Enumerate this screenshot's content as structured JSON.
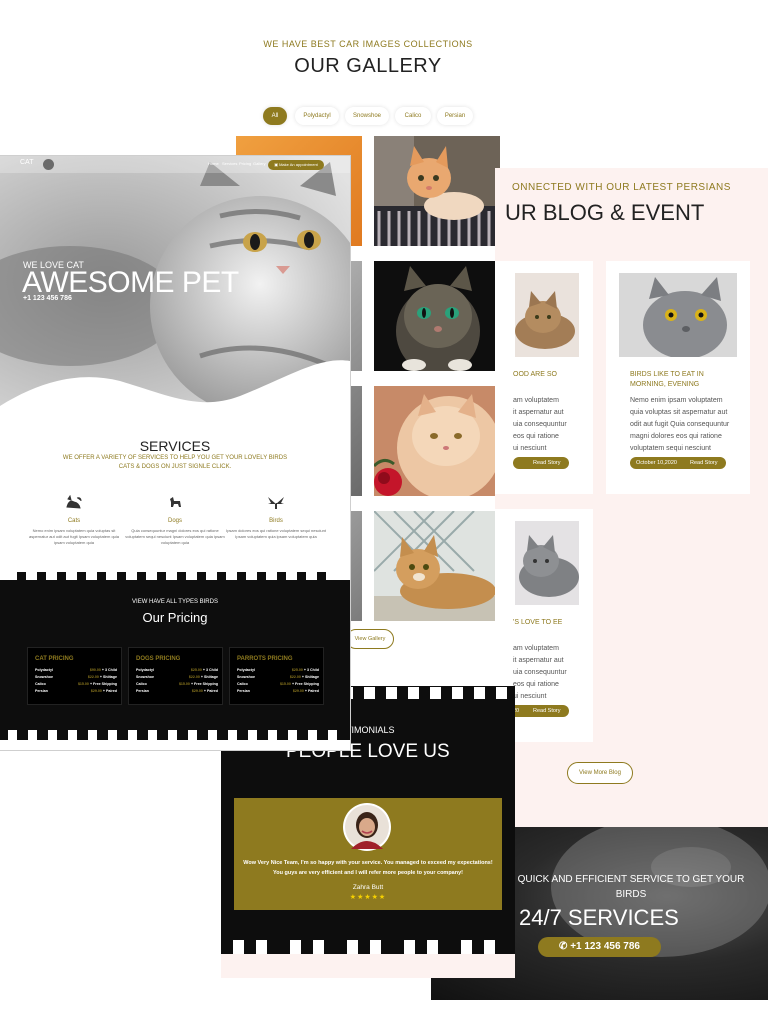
{
  "gallery": {
    "eyebrow": "WE HAVE BEST CAR IMAGES COLLECTIONS",
    "title": "OUR GALLERY",
    "filters": [
      "All",
      "Polydactyl",
      "Snowshoe",
      "Calico",
      "Persian"
    ],
    "view_button": "View Gallery"
  },
  "blog": {
    "eyebrow": "ONNECTED WITH OUR LATEST PERSIANS",
    "title": "UR BLOG & EVENT",
    "cards": [
      {
        "caption": "OOD ARE SO",
        "text": [
          "am voluptatem",
          "it aspernatur aut",
          "uia consequuntur",
          "eos qui ratione",
          "ui nesciunt"
        ],
        "date": "",
        "read": "Read Story"
      },
      {
        "caption": "BIRDS LIKE TO EAT IN MORNING, EVENING",
        "text": [
          "Nemo enim ipsam voluptatem",
          "quia voluptas sit aspernatur aut",
          "odit aut fugit Quia consequuntur",
          "magni dolores eos qui ratione",
          "voluptatem sequi nesciunt"
        ],
        "date": "October 10,2020",
        "read": "Read Story"
      },
      {
        "caption": "'S LOVE TO EE",
        "text": [
          "am voluptatem",
          "it aspernatur aut",
          "uia consequuntur",
          "eos qui ratione",
          "ui nesciunt"
        ],
        "date": "20",
        "read": "Read Story"
      }
    ],
    "view_more": "View More Blog"
  },
  "testimonials": {
    "eyebrow": "STIMONIALS",
    "title": "PEOPLE LOVE US",
    "quote": "Wow Very Nice Team, I'm so happy with your service. You managed to exceed my expectations! You guys are very efficient and I will refer more people to your company!",
    "name": "Zahra Butt",
    "stars": "★★★★★"
  },
  "services_strip": {
    "eyebrow": "QUICK AND EFFICIENT SERVICE TO GET YOUR BIRDS",
    "title": "24/7 SERVICES",
    "phone": "+1 123 456 786"
  },
  "home": {
    "brand": "CAT",
    "nav": [
      "Home",
      "Services",
      "Pricing",
      "Gallery"
    ],
    "appointment": "Make An appointment",
    "hero_small": "WE LOVE CAT",
    "hero_big": "AWESOME PET",
    "hero_phone": "+1 123 456 786",
    "services_title": "SERVICES",
    "services_sub": "WE OFFER A VARIETY OF SERVICES TO HELP YOU GET YOUR LOVELY BIRDS CATS & DOGS ON JUST SIGNLE CLICK.",
    "pets": [
      {
        "name": "Cats",
        "desc": "Nemo enim ipsam voluptatem quia voluptas sit aspernatur aut odit aut fugit Ipsam voluptatem quia ipsam voluptatem quia"
      },
      {
        "name": "Dogs",
        "desc": "Quia consequuntur magni dolores eos qui ratione voluptatem sequi nesciunt Ipsam voluptatem quia ipsam voluptatem quia"
      },
      {
        "name": "Birds",
        "desc": "Ipsam dolores eos qui ratione voluptatem sequi nesciunt Ipsam voluptatem quia ipsam voluptatem quia"
      }
    ],
    "pricing_eyebrow": "VIEW HAVE ALL TYPES BIRDS",
    "pricing_title": "Our Pricing",
    "price_cards": [
      {
        "title": "CAT PRICING",
        "rows": [
          {
            "name": "Polydactyl",
            "price": "$90.00",
            "tag": "+ 3 Child"
          },
          {
            "name": "Snowshoe",
            "price": "$22.00",
            "tag": "+ Shiitage"
          },
          {
            "name": "Calico",
            "price": "$15.00",
            "tag": "+ Free Shipping"
          },
          {
            "name": "Persian",
            "price": "$29.00",
            "tag": "+ Paired"
          }
        ]
      },
      {
        "title": "DOGS PRICING",
        "rows": [
          {
            "name": "Polydactyl",
            "price": "$25.00",
            "tag": "+ 3 Child"
          },
          {
            "name": "Snowshoe",
            "price": "$22.00",
            "tag": "+ Shiitage"
          },
          {
            "name": "Calico",
            "price": "$15.00",
            "tag": "+ Free Shipping"
          },
          {
            "name": "Persian",
            "price": "$29.00",
            "tag": "+ Paired"
          }
        ]
      },
      {
        "title": "PARROTS PRICING",
        "rows": [
          {
            "name": "Polydactyl",
            "price": "$25.00",
            "tag": "+ 3 Child"
          },
          {
            "name": "Snowshoe",
            "price": "$22.00",
            "tag": "+ Shiitage"
          },
          {
            "name": "Calico",
            "price": "$15.00",
            "tag": "+ Free Shipping"
          },
          {
            "name": "Persian",
            "price": "$29.00",
            "tag": "+ Paired"
          }
        ]
      }
    ]
  },
  "colors": {
    "accent": "#8e7a1f",
    "dark": "#0d0d0d",
    "blush": "#fdf2f0"
  }
}
